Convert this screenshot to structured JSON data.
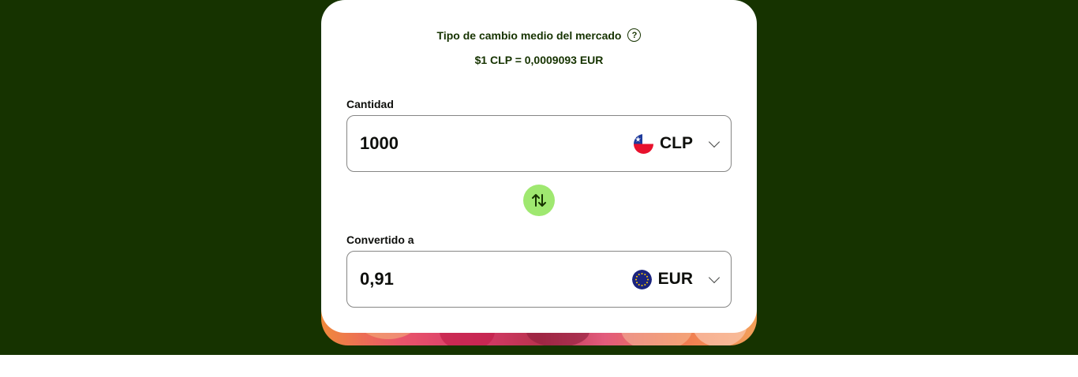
{
  "rate": {
    "title": "Tipo de cambio medio del mercado",
    "value": "$1 CLP = 0,0009093 EUR"
  },
  "source": {
    "label": "Cantidad",
    "amount": "1000",
    "currency": "CLP",
    "flag_icon": "chile-flag-icon"
  },
  "target": {
    "label": "Convertido a",
    "amount": "0,91",
    "currency": "EUR",
    "flag_icon": "eu-flag-icon"
  },
  "colors": {
    "brand_dark": "#163300",
    "accent_green": "#9fe870",
    "text": "#0e0f0c"
  }
}
